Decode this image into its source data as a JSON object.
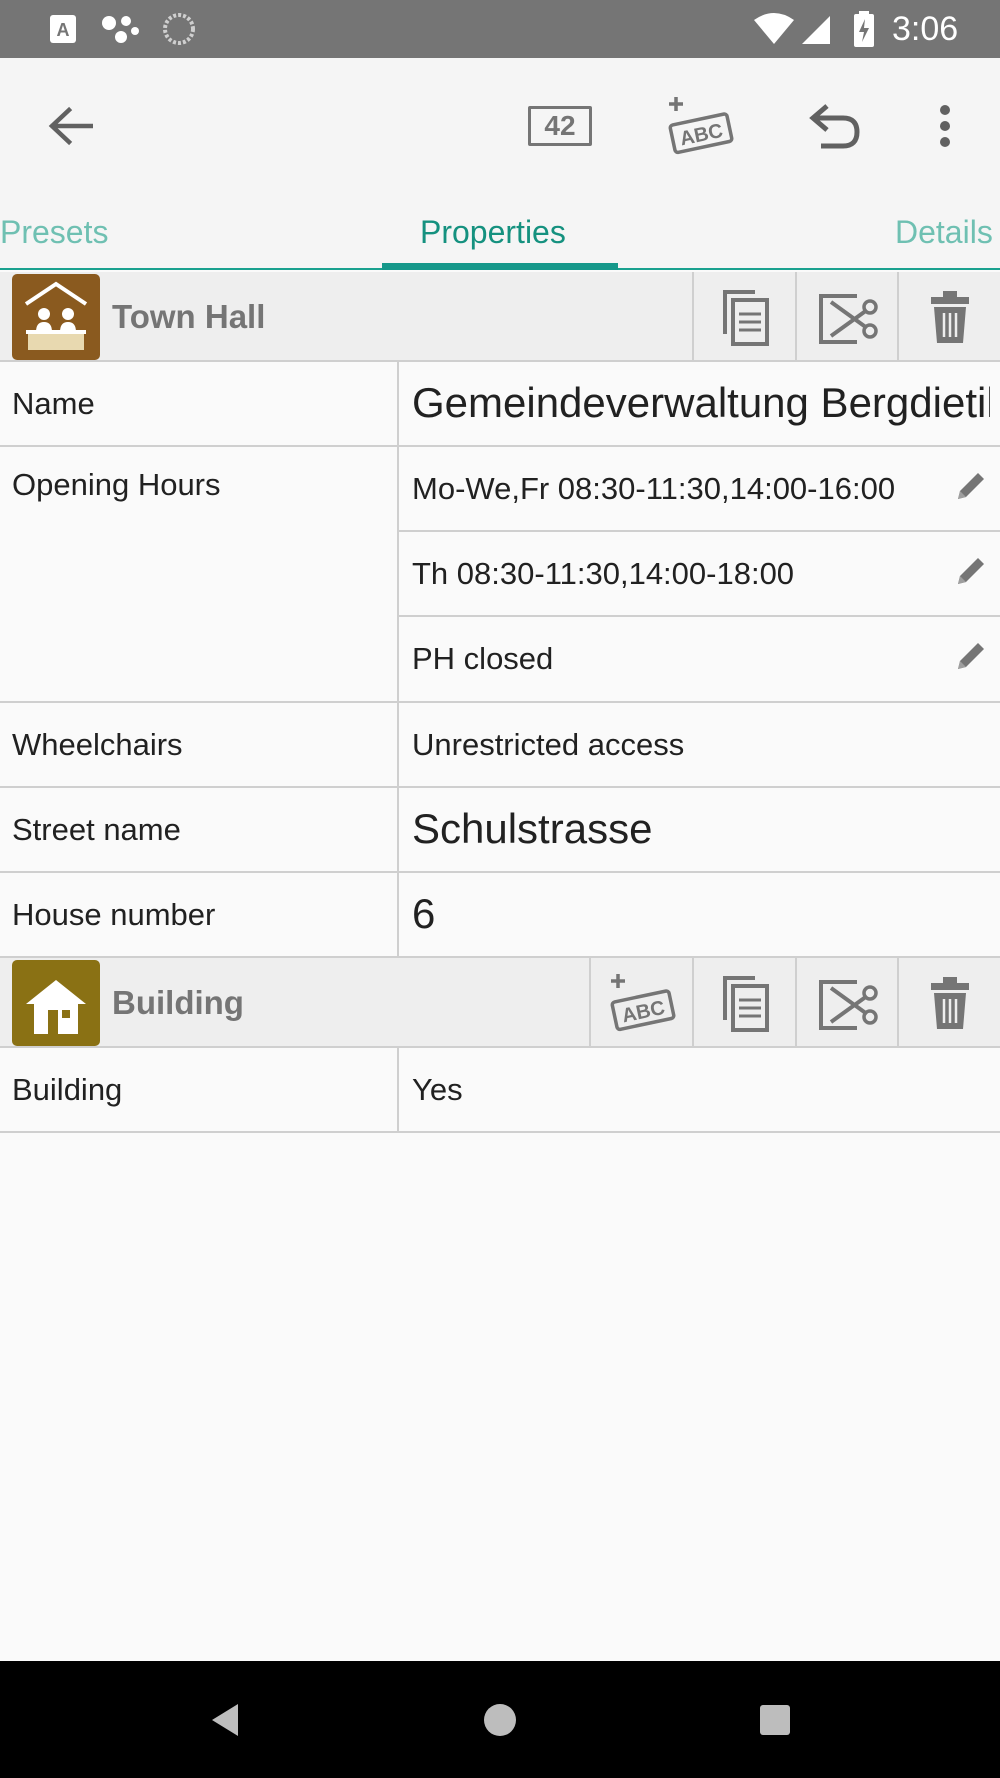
{
  "status_bar": {
    "time": "3:06"
  },
  "toolbar": {
    "counter_label": "42",
    "add_tag_label": "ABC"
  },
  "tabs": [
    {
      "label": "Presets",
      "active": false
    },
    {
      "label": "Properties",
      "active": true
    },
    {
      "label": "Details",
      "active": false
    }
  ],
  "presets": [
    {
      "title": "Town Hall",
      "icon": "town-hall-icon",
      "color": "#8a5a1f"
    },
    {
      "title": "Building",
      "icon": "building-icon",
      "color": "#8a7114"
    }
  ],
  "properties": {
    "name": {
      "label": "Name",
      "value": "Gemeindeverwaltung Bergdietikon"
    },
    "opening_hours": {
      "label": "Opening Hours",
      "values": [
        "Mo-We,Fr 08:30-11:30,14:00-16:00",
        "Th 08:30-11:30,14:00-18:00",
        "PH closed"
      ]
    },
    "wheelchair": {
      "label": "Wheelchairs",
      "value": "Unrestricted access"
    },
    "street": {
      "label": "Street name",
      "value": "Schulstrasse"
    },
    "housenumber": {
      "label": "House number",
      "value": "6"
    },
    "building": {
      "label": "Building",
      "value": "Yes"
    }
  },
  "colors": {
    "accent": "#15917f",
    "accent_light": "#6fc0b2",
    "statusbar": "#757575"
  }
}
